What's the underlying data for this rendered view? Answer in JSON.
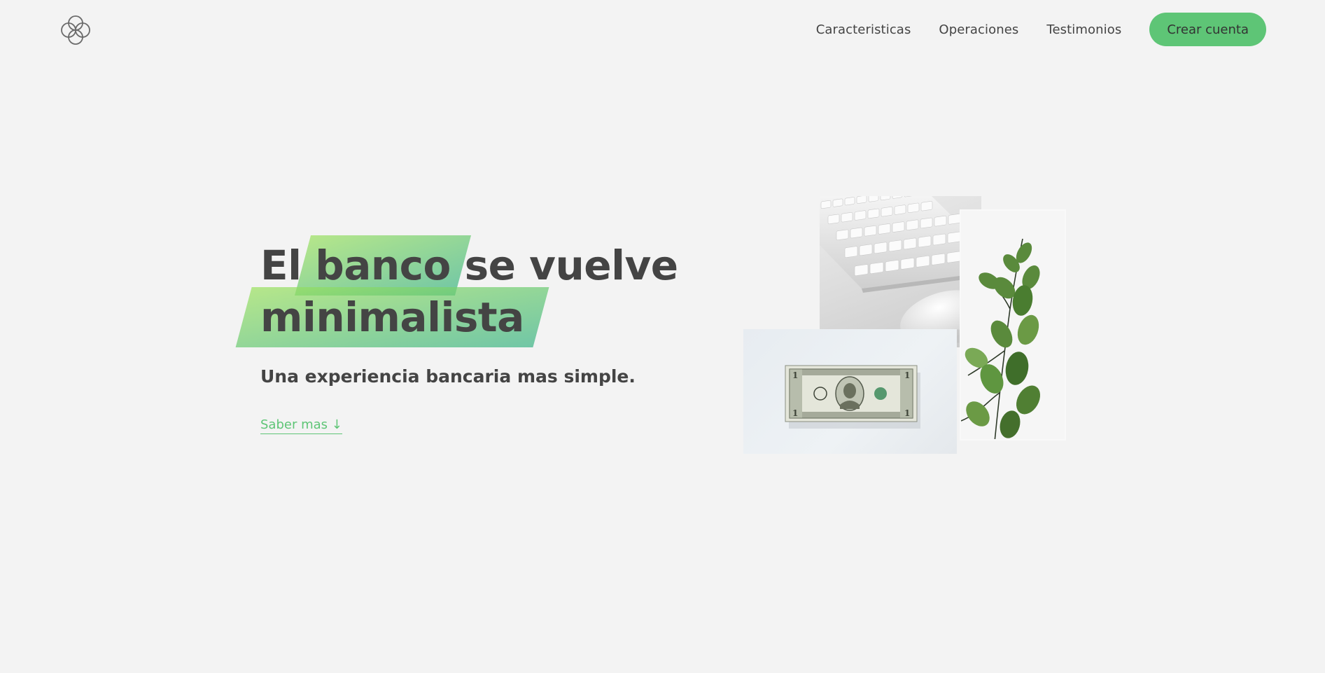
{
  "nav": {
    "logo_icon": "four-circles-logo-icon",
    "links": [
      "Caracteristicas",
      "Operaciones",
      "Testimonios"
    ],
    "cta_label": "Crear cuenta"
  },
  "hero": {
    "title_word_1": "El",
    "title_highlight_1": "banco",
    "title_word_2": "se vuelve",
    "title_highlight_2": "minimalista",
    "subtitle": "Una experiencia bancaria mas simple.",
    "learn_more": "Saber mas ↓"
  },
  "images": [
    "keyboard-mouse-photo",
    "plant-photo",
    "dollar-bill-photo"
  ],
  "colors": {
    "accent": "#5ec576",
    "gradient_start": "#9be15d",
    "gradient_end": "#39b385",
    "text": "#444444",
    "background": "#f3f3f3"
  }
}
